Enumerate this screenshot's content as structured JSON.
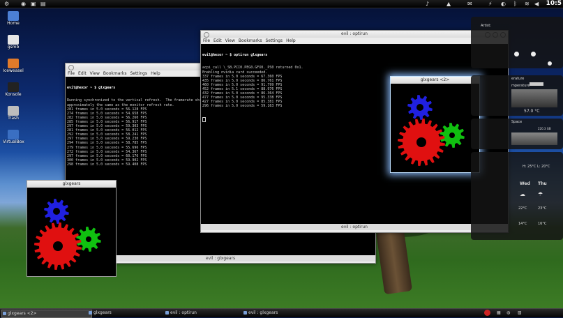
{
  "clock": "10:5",
  "desktop_icons": [
    {
      "label": "Home",
      "icon": "home-folder-icon",
      "color": "#4c7fd4"
    },
    {
      "label": "gsmb",
      "icon": "document-icon",
      "color": "#e6e6e6"
    },
    {
      "label": "Iceweasel",
      "icon": "browser-icon",
      "color": "#e07a2a"
    },
    {
      "label": "Konsole",
      "icon": "terminal-icon",
      "color": "#222"
    },
    {
      "label": "Trash",
      "icon": "trash-icon",
      "color": "#bdbdbd"
    },
    {
      "label": "VirtualBox",
      "icon": "virtualbox-icon",
      "color": "#3a6fc2"
    }
  ],
  "win_back": {
    "title": "",
    "menu": [
      "File",
      "Edit",
      "View",
      "Bookmarks",
      "Settings",
      "Help"
    ],
    "prompt": "evil@hexor ~ $ glxgears",
    "lines": [
      "Running synchronized to the vertical refresh.  The framerate should be",
      "approximately the same as the monitor refresh rate.",
      "281 frames in 5.0 seconds = 56.128 FPS",
      "274 frames in 5.0 seconds = 54.658 FPS",
      "282 frames in 5.0 seconds = 56.260 FPS",
      "285 frames in 5.0 seconds = 56.917 FPS",
      "297 frames in 5.0 seconds = 59.303 FPS",
      "281 frames in 5.0 seconds = 56.012 FPS",
      "292 frames in 5.0 seconds = 58.241 FPS",
      "297 frames in 5.0 seconds = 59.230 FPS",
      "294 frames in 5.0 seconds = 58.785 FPS",
      "279 frames in 5.0 seconds = 55.696 FPS",
      "272 frames in 5.0 seconds = 54.367 FPS",
      "297 frames in 5.0 seconds = 60.176 FPS",
      "300 frames in 5.0 seconds = 59.902 FPS",
      "298 frames in 5.0 seconds = 59.408 FPS"
    ],
    "status": "evil : glxgears"
  },
  "win_front": {
    "title": "evil : optirun",
    "menu": [
      "File",
      "Edit",
      "View",
      "Bookmarks",
      "Settings",
      "Help"
    ],
    "prompt": "evil@hexor ~ $ optirun glxgears",
    "lines": [
      "acpi_call \\_SB.PCI0.PEG0.GFX0._PS0 returned 0x1.",
      "Enabling nvidia card succeeded.",
      "337 frames in 5.0 seconds = 67.360 FPS",
      "435 frames in 5.0 seconds = 86.761 FPS",
      "460 frames in 5.0 seconds = 91.799 FPS",
      "452 frames in 5.1 seconds = 88.976 FPS",
      "432 frames in 5.0 seconds = 86.364 FPS",
      "477 frames in 5.0 seconds = 95.338 FPS",
      "427 frames in 5.0 seconds = 85.381 FPS",
      "296 frames in 5.0 seconds = 59.163 FPS"
    ],
    "status": "evil : optirun"
  },
  "gears_small": {
    "title": "glxgears"
  },
  "gears_glow": {
    "title": "glxgears <2>"
  },
  "widgets": {
    "artist_label": "Artist:",
    "temp_title": "erature",
    "temp_label": "mperature",
    "temp_value": "57.0 °C",
    "space_title": "Space",
    "space_value": "220.3 GB",
    "weather_hilo": "H: 25°C  L: 20°C",
    "day1": "Wed",
    "day2": "Thu",
    "day1_hi": "22°C",
    "day2_hi": "23°C",
    "day1_lo": "14°C",
    "day2_lo": "16°C"
  },
  "taskbar": [
    {
      "label": "glxgears <2>",
      "active": true
    },
    {
      "label": "glxgears",
      "active": false
    },
    {
      "label": "evil : optirun",
      "active": false
    },
    {
      "label": "evil : glxgears",
      "active": false
    }
  ],
  "colors": {
    "gear_red": "#e01010",
    "gear_green": "#10c010",
    "gear_blue": "#2020e0"
  }
}
